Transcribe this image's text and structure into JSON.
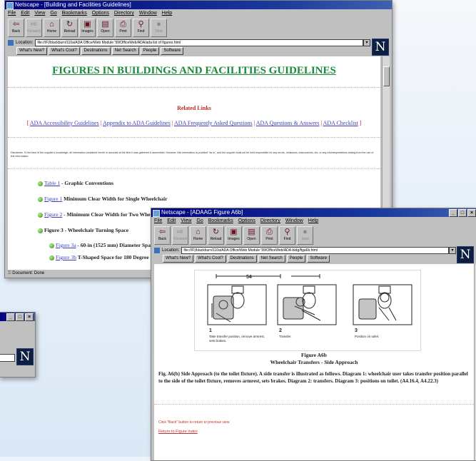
{
  "main_window": {
    "title": "Netscape - [Building and Facilities Guidelines]",
    "menu": [
      "File",
      "Edit",
      "View",
      "Go",
      "Bookmarks",
      "Options",
      "Directory",
      "Window",
      "Help"
    ],
    "toolbar": [
      {
        "label": "Back",
        "icon": "back-arrow-icon",
        "glyph": "⇦",
        "enabled": true
      },
      {
        "label": "Forward",
        "icon": "forward-arrow-icon",
        "glyph": "⇨",
        "enabled": false
      },
      {
        "label": "Home",
        "icon": "home-icon",
        "glyph": "⌂",
        "enabled": true
      },
      {
        "label": "Reload",
        "icon": "reload-icon",
        "glyph": "↻",
        "enabled": true
      },
      {
        "label": "Images",
        "icon": "images-icon",
        "glyph": "▣",
        "enabled": true
      },
      {
        "label": "Open",
        "icon": "open-icon",
        "glyph": "▤",
        "enabled": true
      },
      {
        "label": "Print",
        "icon": "print-icon",
        "glyph": "⎙",
        "enabled": true
      },
      {
        "label": "Find",
        "icon": "find-icon",
        "glyph": "⚲",
        "enabled": true
      },
      {
        "label": "Stop",
        "icon": "stop-icon",
        "glyph": "●",
        "enabled": false
      }
    ],
    "location_label": "Location:",
    "location_url": "file:///F|/blackburn/110a/ADA Office/Web Module '99/OfficeWeb/ADA/ada list of figures.html",
    "directory_buttons": [
      "What's New?",
      "What's Cool?",
      "Destinations",
      "Net Search",
      "People",
      "Software"
    ],
    "page": {
      "heading": "FIGURES IN BUILDINGS AND FACILITIES GUIDELINES",
      "related_title": "Related Links",
      "related_links": [
        "ADA Accessibility Guidelines",
        "Appendix to ADA Guidelines",
        "ADA Frequently Asked Questions",
        "ADA Questions & Answers",
        "ADA Checklist"
      ],
      "disclaimer": "Disclaimer. To the best of the supplier's knowledge, all information contained herein is accurate at the time it was gathered & assembled. However, this information is provided \"as is\", and the supplier shall not be held responsible for any errors, omissions, inaccuracies, etc. or any misinterpretations arising from the use of this information.",
      "figures": [
        {
          "link": "Table 1",
          "text": " - Graphic Conventions"
        },
        {
          "link": "Figure 1",
          "text": " Minimum Clear Width for Single Wheelchair"
        },
        {
          "link": "Figure 2",
          "text": " - Minimum Clear Width for Two Whee"
        },
        {
          "link": "",
          "text": "Figure 3 - Wheelchair Turning Space"
        }
      ],
      "subfigures": [
        {
          "link": "Figure 3a",
          "text": " - 60-in (1525 mm) Diameter Spa"
        },
        {
          "link": "Figure 3b",
          "text": " T-Shaped Space for 180 Degree"
        }
      ]
    },
    "status": "Document: Done"
  },
  "figure_window": {
    "title": "Netscape - [ADAAG Figure A6b]",
    "menu": [
      "File",
      "Edit",
      "View",
      "Go",
      "Bookmarks",
      "Options",
      "Directory",
      "Window",
      "Help"
    ],
    "toolbar_labels": [
      "Back",
      "Forward",
      "Home",
      "Reload",
      "Images",
      "Open",
      "Print",
      "Find",
      "Stop"
    ],
    "location_label": "Location:",
    "location_url": "file:///F|/blackburn/110a/ADA Office/Web Module '99/OfficeWeb/ADA-bldg/figa6b.html",
    "directory_buttons": [
      "What's New?",
      "What's Cool?",
      "Destinations",
      "Net Search",
      "People",
      "Software"
    ],
    "dimension_label": "54",
    "panels": [
      {
        "num": "1",
        "caption": "Take transfer position, remove armrest, sets brakes."
      },
      {
        "num": "2",
        "caption": "Transfer."
      },
      {
        "num": "3",
        "caption": "Position on toilet."
      }
    ],
    "figure_title": "Figure A6b",
    "figure_subtitle": "Wheelchair Transfers - Side Approach",
    "description": "Fig. A6(b) Side Approach (to the toilet fixture). A side transfer is illustrated as follows. Diagram 1: wheelchair user takes transfer position parallel to the side of the toilet fixture, removes armrest, sets brakes. Diagram 2: transfers. Diagram 3: positions on toilet. (A4.16.4, A4.22.3)",
    "back_note": "Click \"Back\" button to return to previous view",
    "return_link": "Return to Figure Index"
  },
  "back_window": {
    "title_buttons": [
      "_",
      "□",
      "×"
    ]
  },
  "colors": {
    "title_bar": "#00007c",
    "heading_green": "#1a8a3a",
    "related_red": "#c02828",
    "link_blue": "#3a3ac8",
    "note_red": "#c03030"
  }
}
